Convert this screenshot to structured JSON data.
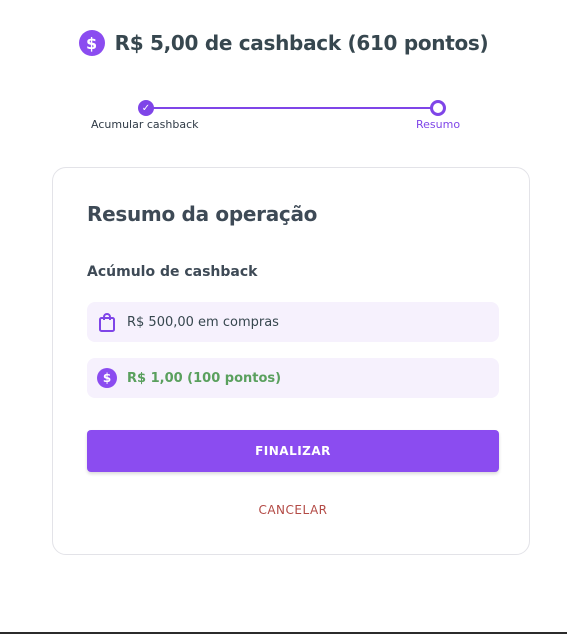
{
  "header": {
    "title": "R$ 5,00 de cashback (610 pontos)",
    "icon": "coin-dollar-icon"
  },
  "stepper": {
    "steps": [
      {
        "label": "Acumular cashback",
        "status": "done"
      },
      {
        "label": "Resumo",
        "status": "current"
      }
    ]
  },
  "card": {
    "title": "Resumo da operação",
    "section_title": "Acúmulo de cashback",
    "rows": [
      {
        "icon": "shopping-bag-icon",
        "text": "R$ 500,00 em compras"
      },
      {
        "icon": "coin-dollar-icon",
        "text": "R$ 1,00 (100 pontos)"
      }
    ],
    "finalize_label": "FINALIZAR",
    "cancel_label": "CANCELAR"
  },
  "colors": {
    "accent": "#8b4cf0",
    "success_text": "#5aa05e",
    "danger_text": "#b34a45"
  }
}
